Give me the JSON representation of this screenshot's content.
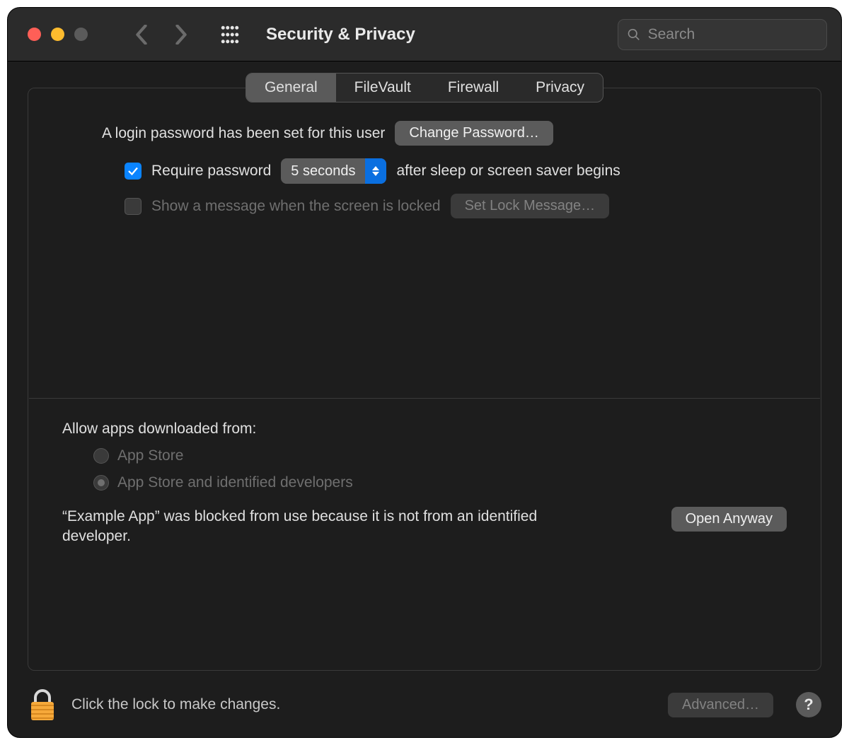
{
  "toolbar": {
    "title": "Security & Privacy",
    "search_placeholder": "Search"
  },
  "tabs": [
    {
      "label": "General",
      "selected": true
    },
    {
      "label": "FileVault",
      "selected": false
    },
    {
      "label": "Firewall",
      "selected": false
    },
    {
      "label": "Privacy",
      "selected": false
    }
  ],
  "general": {
    "login_password_text": "A login password has been set for this user",
    "change_password_label": "Change Password…",
    "require_password_label": "Require password",
    "require_password_delay": "5 seconds",
    "after_sleep_text": "after sleep or screen saver begins",
    "show_message_label": "Show a message when the screen is locked",
    "set_lock_message_label": "Set Lock Message…"
  },
  "allow_apps": {
    "title": "Allow apps downloaded from:",
    "options": [
      {
        "label": "App Store",
        "selected": false
      },
      {
        "label": "App Store and identified developers",
        "selected": true
      }
    ],
    "blocked_message": "“Example App” was blocked from use because it is not from an identified developer.",
    "open_anyway_label": "Open Anyway"
  },
  "footer": {
    "lock_text": "Click the lock to make changes.",
    "advanced_label": "Advanced…",
    "help_label": "?"
  }
}
